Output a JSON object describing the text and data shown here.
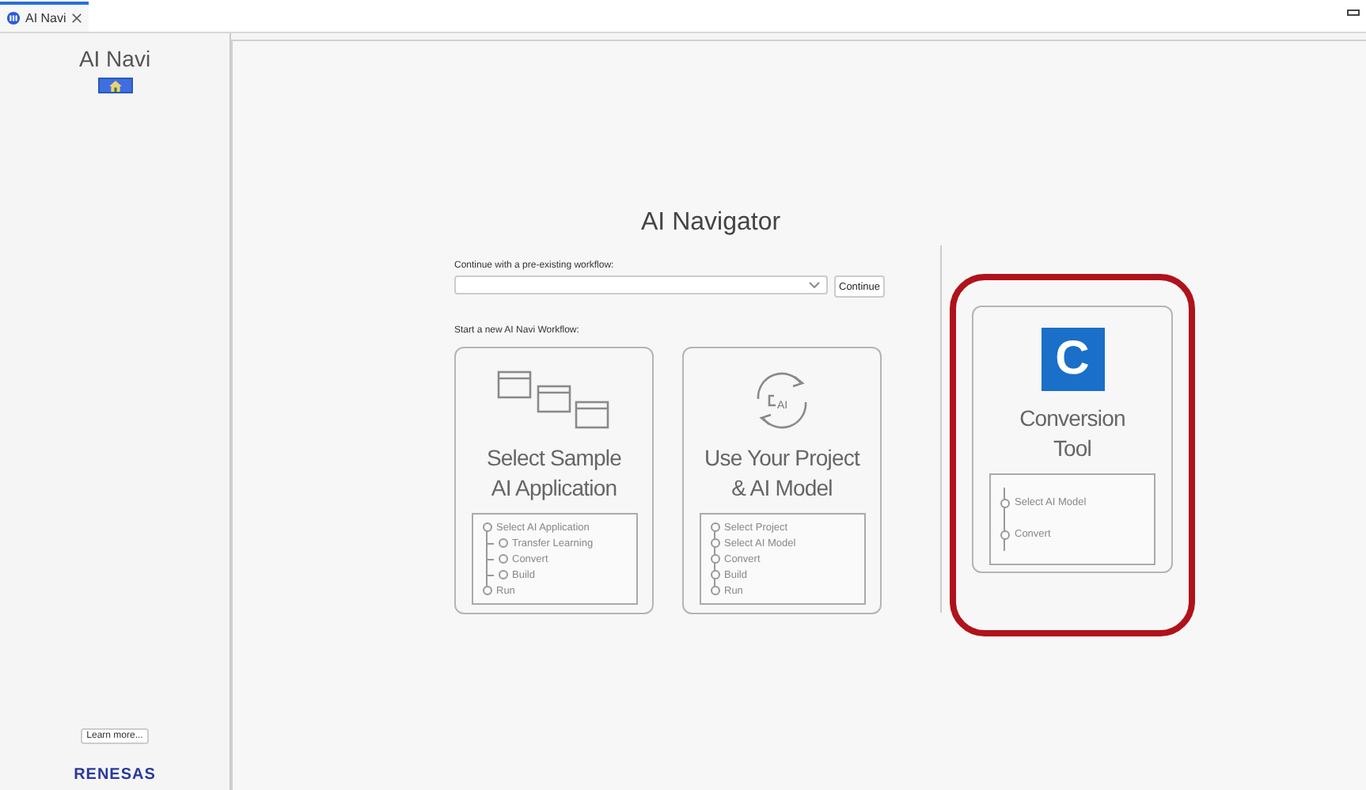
{
  "tab": {
    "title": "AI Navi",
    "selected": true
  },
  "sidebar": {
    "title": "AI Navi",
    "learn_more": "Learn more...",
    "logo": "RENESAS"
  },
  "navigator": {
    "title": "AI Navigator",
    "continue_label": "Continue with a pre-existing workflow:",
    "continue_button": "Continue",
    "new_label": "Start a new AI Navi Workflow:",
    "cards": [
      {
        "kind": "windows",
        "title_lines": [
          "Select Sample",
          "AI Application"
        ],
        "highlighted": false,
        "steps": [
          {
            "label": "Select AI Application",
            "children": [
              {
                "label": "Transfer Learning"
              },
              {
                "label": "Convert"
              },
              {
                "label": "Build"
              }
            ]
          },
          {
            "label": "Run"
          }
        ]
      },
      {
        "kind": "sync",
        "icon_text": "AI",
        "title_lines": [
          "Use Your Project",
          "& AI Model"
        ],
        "highlighted": false,
        "steps": [
          {
            "label": "Select Project"
          },
          {
            "label": "Select AI Model"
          },
          {
            "label": "Convert"
          },
          {
            "label": "Build"
          },
          {
            "label": "Run"
          }
        ]
      },
      {
        "kind": "logo",
        "logo_letter": "C",
        "title_lines": [
          "Conversion",
          "Tool"
        ],
        "highlighted": true,
        "steps": [
          {
            "label": "Select AI Model"
          },
          {
            "label": "Convert"
          }
        ]
      }
    ]
  }
}
